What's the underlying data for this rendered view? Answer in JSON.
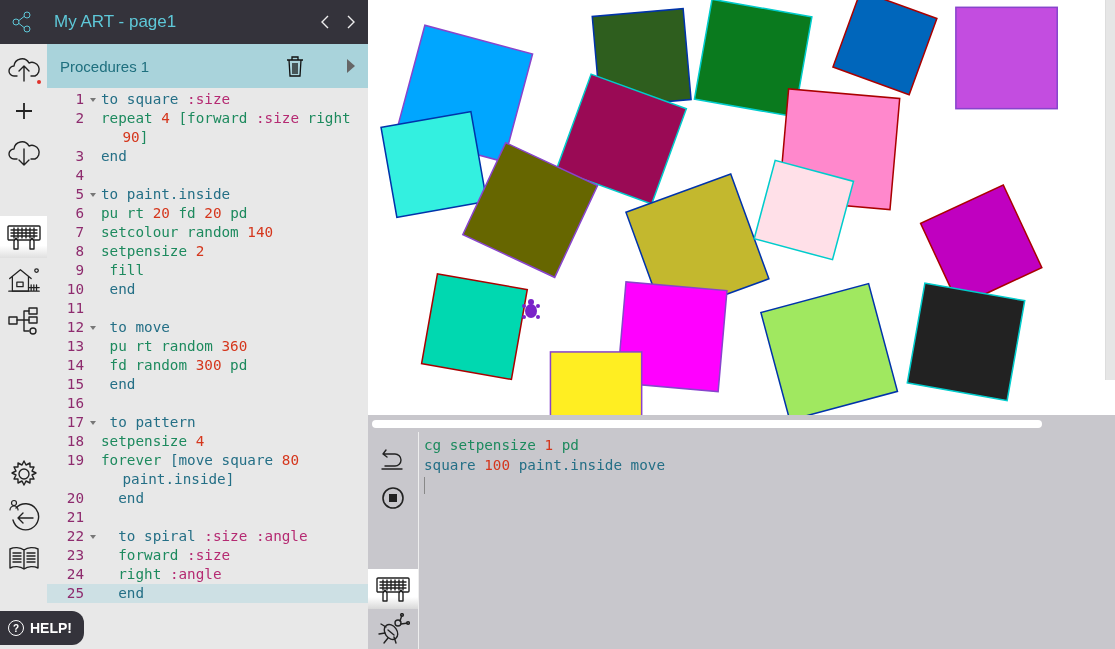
{
  "header": {
    "title": "My ART - page1"
  },
  "tool_groups": [
    [
      {
        "selected": false,
        "notification_dot": true
      },
      {
        "selected": false,
        "notification_dot": false
      },
      {
        "selected": false,
        "notification_dot": false
      }
    ],
    [
      {
        "selected": true,
        "notification_dot": false
      },
      {
        "selected": false,
        "notification_dot": false
      },
      {
        "selected": false,
        "notification_dot": false
      }
    ],
    [
      {
        "selected": false,
        "notification_dot": false
      },
      {
        "selected": false,
        "notification_dot": false
      },
      {
        "selected": false,
        "notification_dot": false
      }
    ]
  ],
  "procedures_tab": {
    "label": "Procedures 1"
  },
  "editor": {
    "lines": [
      {
        "number": "1",
        "fold": true,
        "active": false,
        "tokens": [
          {
            "t": "to square ",
            "kind": "proc"
          },
          {
            "t": ":size",
            "kind": "param"
          }
        ]
      },
      {
        "number": "2",
        "fold": false,
        "active": false,
        "tokens": [
          {
            "t": "repeat ",
            "kind": "cmd"
          },
          {
            "t": "4",
            "kind": "num"
          },
          {
            "t": " [forward ",
            "kind": "cmd"
          },
          {
            "t": ":size",
            "kind": "param"
          },
          {
            "t": " right ",
            "kind": "cmd"
          },
          {
            "t": "90",
            "kind": "num"
          },
          {
            "t": "]",
            "kind": "cmd"
          }
        ]
      },
      {
        "number": "3",
        "fold": false,
        "active": false,
        "tokens": [
          {
            "t": "end",
            "kind": "proc"
          }
        ]
      },
      {
        "number": "4",
        "fold": false,
        "active": false
      },
      {
        "number": "5",
        "fold": true,
        "active": false,
        "tokens": [
          {
            "t": "to paint.inside",
            "kind": "proc"
          }
        ]
      },
      {
        "number": "6",
        "fold": false,
        "active": false,
        "tokens": [
          {
            "t": "pu rt ",
            "kind": "cmd"
          },
          {
            "t": "20",
            "kind": "num"
          },
          {
            "t": " fd ",
            "kind": "cmd"
          },
          {
            "t": "20",
            "kind": "num"
          },
          {
            "t": " pd",
            "kind": "cmd"
          }
        ]
      },
      {
        "number": "7",
        "fold": false,
        "active": false,
        "tokens": [
          {
            "t": "setcolour random ",
            "kind": "cmd"
          },
          {
            "t": "140",
            "kind": "num"
          }
        ]
      },
      {
        "number": "8",
        "fold": false,
        "active": false,
        "tokens": [
          {
            "t": "setpensize ",
            "kind": "cmd"
          },
          {
            "t": "2",
            "kind": "num"
          }
        ]
      },
      {
        "number": "9",
        "fold": false,
        "active": false,
        "tokens": [
          {
            "t": " fill",
            "kind": "cmd"
          }
        ]
      },
      {
        "number": "10",
        "fold": false,
        "active": false,
        "tokens": [
          {
            "t": " end",
            "kind": "proc"
          }
        ]
      },
      {
        "number": "11",
        "fold": false,
        "active": false
      },
      {
        "number": "12",
        "fold": true,
        "active": false,
        "tokens": [
          {
            "t": " to move",
            "kind": "proc"
          }
        ]
      },
      {
        "number": "13",
        "fold": false,
        "active": false,
        "tokens": [
          {
            "t": " pu rt random ",
            "kind": "cmd"
          },
          {
            "t": "360",
            "kind": "num"
          }
        ]
      },
      {
        "number": "14",
        "fold": false,
        "active": false,
        "tokens": [
          {
            "t": " fd random ",
            "kind": "cmd"
          },
          {
            "t": "300",
            "kind": "num"
          },
          {
            "t": " pd",
            "kind": "cmd"
          }
        ]
      },
      {
        "number": "15",
        "fold": false,
        "active": false,
        "tokens": [
          {
            "t": " end",
            "kind": "proc"
          }
        ]
      },
      {
        "number": "16",
        "fold": false,
        "active": false
      },
      {
        "number": "17",
        "fold": true,
        "active": false,
        "tokens": [
          {
            "t": " to pattern",
            "kind": "proc"
          }
        ]
      },
      {
        "number": "18",
        "fold": false,
        "active": false,
        "tokens": [
          {
            "t": "setpensize ",
            "kind": "cmd"
          },
          {
            "t": "4",
            "kind": "num"
          }
        ]
      },
      {
        "number": "19",
        "fold": false,
        "active": false,
        "tokens": [
          {
            "t": "forever ",
            "kind": "cmd"
          },
          {
            "t": "[move square ",
            "kind": "proc"
          },
          {
            "t": "80",
            "kind": "num"
          },
          {
            "t": " paint.inside]",
            "kind": "proc"
          }
        ]
      },
      {
        "number": "20",
        "fold": false,
        "active": false,
        "tokens": [
          {
            "t": "  end",
            "kind": "proc"
          }
        ]
      },
      {
        "number": "21",
        "fold": false,
        "active": false
      },
      {
        "number": "22",
        "fold": true,
        "active": false,
        "tokens": [
          {
            "t": "  to spiral ",
            "kind": "proc"
          },
          {
            "t": ":size :angle",
            "kind": "param"
          }
        ]
      },
      {
        "number": "23",
        "fold": false,
        "active": false,
        "tokens": [
          {
            "t": "  forward ",
            "kind": "cmd"
          },
          {
            "t": ":size",
            "kind": "param"
          }
        ]
      },
      {
        "number": "24",
        "fold": false,
        "active": false,
        "tokens": [
          {
            "t": "  right ",
            "kind": "cmd"
          },
          {
            "t": ":angle",
            "kind": "param"
          }
        ]
      },
      {
        "number": "25",
        "fold": false,
        "active": true,
        "tokens": [
          {
            "t": "  end",
            "kind": "proc"
          }
        ]
      }
    ]
  },
  "help_button": {
    "icon": "?",
    "label": "HELP!"
  },
  "canvas": {
    "kind": "picture"
  },
  "console": {
    "lines": [
      {
        "tokens": [
          {
            "t": "cg setpensize ",
            "kind": "cmd"
          },
          {
            "t": "1",
            "kind": "num"
          },
          {
            "t": " pd",
            "kind": "cmd"
          }
        ]
      },
      {
        "tokens": [
          {
            "t": "square ",
            "kind": "proc"
          },
          {
            "t": "100",
            "kind": "num"
          },
          {
            "t": " paint.inside move",
            "kind": "proc"
          }
        ]
      }
    ]
  },
  "console_tools": [
    {
      "selected": false
    },
    {
      "selected": false
    },
    {
      "selected": true
    },
    {
      "selected": false
    }
  ]
}
